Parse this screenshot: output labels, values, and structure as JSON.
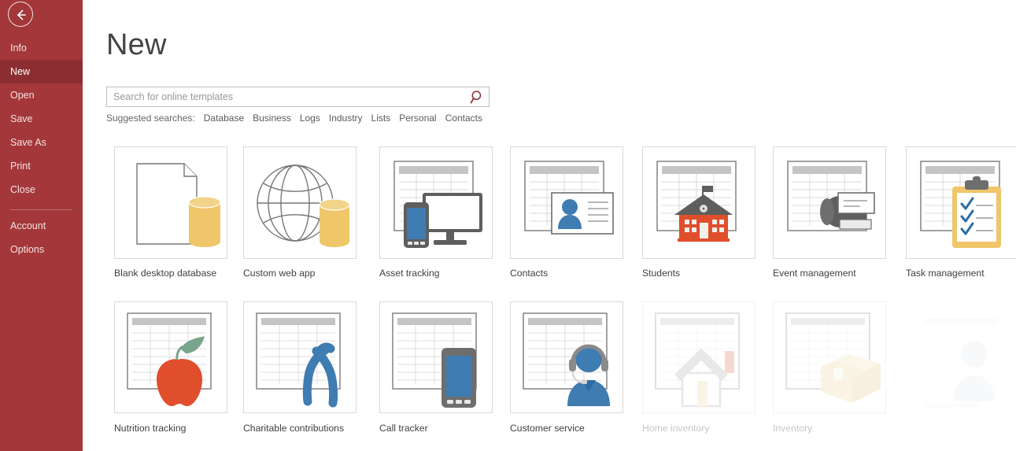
{
  "sidebar": {
    "back_label": "back-arrow",
    "items": [
      {
        "label": "Info",
        "active": false
      },
      {
        "label": "New",
        "active": true
      },
      {
        "label": "Open",
        "active": false
      },
      {
        "label": "Save",
        "active": false
      },
      {
        "label": "Save As",
        "active": false
      },
      {
        "label": "Print",
        "active": false
      },
      {
        "label": "Close",
        "active": false
      },
      {
        "label": "Account",
        "active": false
      },
      {
        "label": "Options",
        "active": false
      }
    ],
    "bg_color": "#A4373A",
    "active_color": "#8C2E31"
  },
  "main": {
    "title": "New",
    "search": {
      "value": "",
      "placeholder": "Search for online templates",
      "button_icon": "search-icon",
      "icon_color": "#8C2E31"
    },
    "suggested": {
      "label": "Suggested searches:",
      "links": [
        "Database",
        "Business",
        "Logs",
        "Industry",
        "Lists",
        "Personal",
        "Contacts"
      ]
    },
    "templates_row1": [
      {
        "name": "Blank desktop database",
        "icon": "blank-document-database-icon",
        "state": "normal"
      },
      {
        "name": "Custom web app",
        "icon": "globe-database-icon",
        "state": "normal"
      },
      {
        "name": "Asset tracking",
        "icon": "monitor-phone-icon",
        "state": "normal"
      },
      {
        "name": "Contacts",
        "icon": "contact-card-icon",
        "state": "normal"
      },
      {
        "name": "Students",
        "icon": "school-building-icon",
        "state": "normal"
      },
      {
        "name": "Event management",
        "icon": "fax-machine-icon",
        "state": "normal"
      },
      {
        "name": "Task management",
        "icon": "clipboard-checklist-icon",
        "state": "normal"
      }
    ],
    "templates_row2": [
      {
        "name": "Nutrition tracking",
        "icon": "apple-icon",
        "state": "normal"
      },
      {
        "name": "Charitable contributions",
        "icon": "ribbon-icon",
        "state": "normal"
      },
      {
        "name": "Call tracker",
        "icon": "smartphone-icon",
        "state": "normal"
      },
      {
        "name": "Customer service",
        "icon": "headset-agent-icon",
        "state": "normal"
      },
      {
        "name": "Home inventory",
        "icon": "house-icon",
        "state": "faded"
      },
      {
        "name": "Inventory",
        "icon": "cardboard-box-icon",
        "state": "faded"
      },
      {
        "name": "",
        "icon": "loading-tile",
        "state": "ghost"
      }
    ],
    "colors": {
      "gold": "#EFC669",
      "tan": "#F2DDAE",
      "blue": "#3E7CB1",
      "blue_dark": "#2E6DA4",
      "red_orange": "#E04E2B",
      "gray": "#767676",
      "gray_light": "#C9C9C9",
      "green": "#78A58B"
    }
  }
}
